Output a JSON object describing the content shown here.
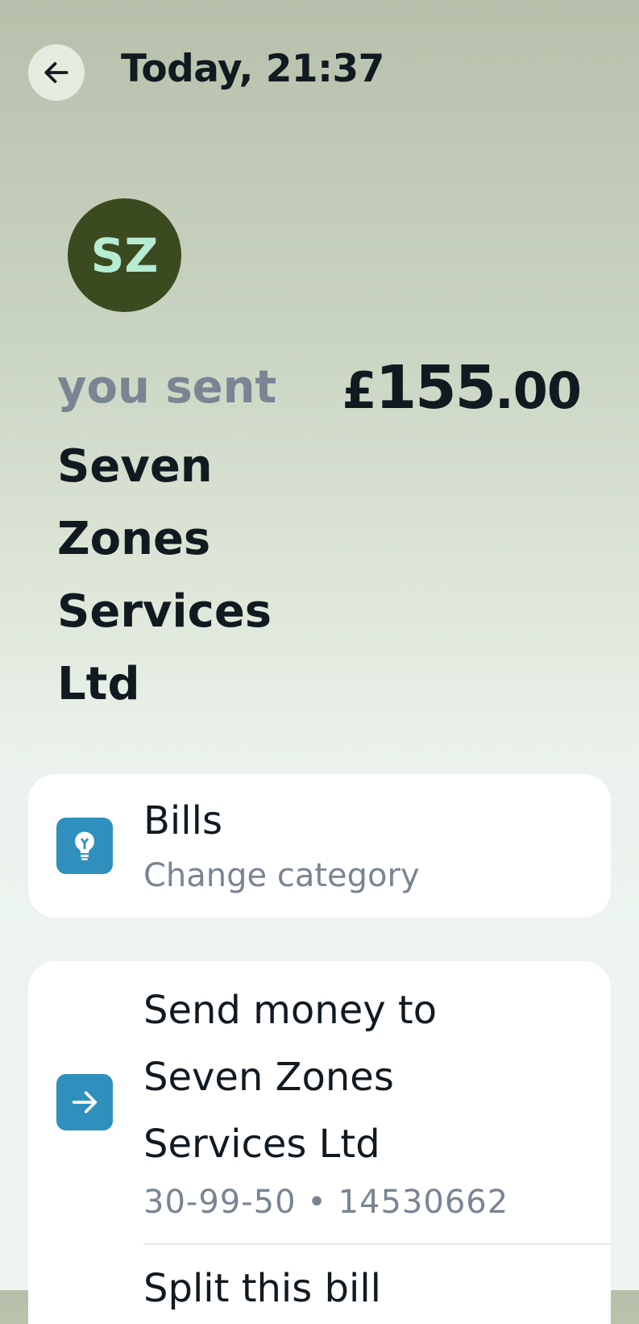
{
  "header": {
    "title": "Today, 21:37",
    "back_icon": "arrow-left-icon"
  },
  "payee": {
    "initials": "SZ",
    "sent_label": "you sent",
    "name": "Seven Zones Services Ltd",
    "name_lines": [
      "Seven",
      "Zones",
      "Services",
      "Ltd"
    ]
  },
  "amount": {
    "currency": "£",
    "whole": "155",
    "decimal": ".00"
  },
  "category": {
    "title": "Bills",
    "action": "Change category",
    "icon": "lightbulb-icon"
  },
  "send": {
    "lines": [
      "Send money to",
      "Seven Zones",
      "Services Ltd"
    ],
    "account": "30-99-50 • 14530662",
    "icon": "arrow-right-icon"
  },
  "split": {
    "label": "Split this bill"
  },
  "colors": {
    "accent": "#2f8fbd",
    "avatar_bg": "#3c4a20",
    "avatar_text": "#b6ebd4"
  }
}
